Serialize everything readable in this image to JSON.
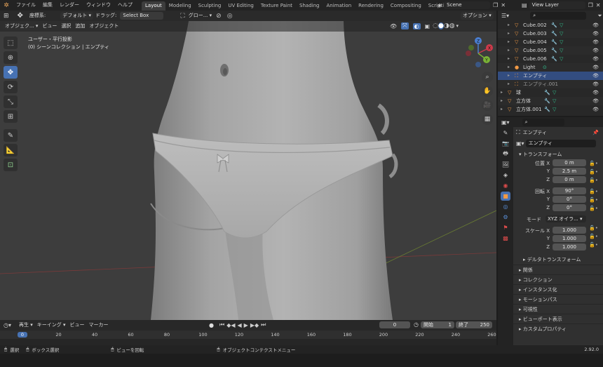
{
  "menu": {
    "items": [
      "ファイル",
      "編集",
      "レンダー",
      "ウィンドウ",
      "ヘルプ"
    ],
    "workspaces": [
      "Layout",
      "Modeling",
      "Sculpting",
      "UV Editing",
      "Texture Paint",
      "Shading",
      "Animation",
      "Rendering",
      "Compositing",
      "Scripting"
    ],
    "active_workspace": "Layout",
    "scene": "Scene",
    "view_layer": "View Layer"
  },
  "tool_header": {
    "coord_label": "座標系:",
    "coord_value": "デフォルト",
    "drag_label": "ドラッグ:",
    "drag_value": "Select Box",
    "pivot_value": "グロー...",
    "options": "オプション"
  },
  "viewport": {
    "mode": "オブジェク...",
    "menus": [
      "ビュー",
      "選択",
      "追加",
      "オブジェクト"
    ],
    "view_name": "ユーザー・平行投影",
    "collection_info": "(0) シーンコレクション | エンプティ",
    "gizmo": {
      "x": "X",
      "y": "Y",
      "z": "Z"
    },
    "colors": {
      "bg": "#3d3d3d",
      "x_axis": "#a33b3b",
      "y_axis": "#7a9a2e",
      "accent": "#4772b3"
    }
  },
  "outliner": {
    "rows": [
      {
        "name": "Cube.002",
        "type": "mesh",
        "selected": false
      },
      {
        "name": "Cube.003",
        "type": "mesh",
        "selected": false
      },
      {
        "name": "Cube.004",
        "type": "mesh",
        "selected": false
      },
      {
        "name": "Cube.005",
        "type": "mesh",
        "selected": false
      },
      {
        "name": "Cube.006",
        "type": "mesh",
        "selected": false
      },
      {
        "name": "Light",
        "type": "light",
        "selected": false
      },
      {
        "name": "エンプティ",
        "type": "empty",
        "selected": true
      },
      {
        "name": "エンプティ.001",
        "type": "empty",
        "selected": false
      },
      {
        "name": "球",
        "type": "mesh",
        "selected": false
      },
      {
        "name": "立方体",
        "type": "mesh",
        "selected": false
      },
      {
        "name": "立方体.001",
        "type": "mesh",
        "selected": false
      }
    ]
  },
  "properties": {
    "object_name": "エンプティ",
    "data_name": "エンプティ",
    "transform_title": "トランスフォーム",
    "location": {
      "label": "位置 X",
      "x": "0 m",
      "y": "2.5 m",
      "z": "0 m"
    },
    "rotation": {
      "label": "回転 X",
      "x": "90°",
      "y": "0°",
      "z": "0°"
    },
    "mode_label": "モード",
    "mode_value": "XYZ オイラ...",
    "scale": {
      "label": "スケール X",
      "x": "1.000",
      "y": "1.000",
      "z": "1.000"
    },
    "axis_y": "Y",
    "axis_z": "Z",
    "delta": "デルタトランスフォーム",
    "sections": [
      "関係",
      "コレクション",
      "インスタンス化",
      "モーションパス",
      "可視性",
      "ビューポート表示",
      "カスタムプロパティ"
    ]
  },
  "timeline": {
    "menus": [
      "再生",
      "キーイング",
      "ビュー",
      "マーカー"
    ],
    "current_frame": "0",
    "start_label": "開始",
    "start_value": "1",
    "end_label": "終了",
    "end_value": "250",
    "ruler": [
      "0",
      "20",
      "40",
      "60",
      "80",
      "100",
      "120",
      "140",
      "160",
      "180",
      "200",
      "220",
      "240",
      "260"
    ]
  },
  "status": {
    "select": "選択",
    "box_select": "ボックス選択",
    "rotate_view": "ビューを回転",
    "context_menu": "オブジェクトコンテクストメニュー",
    "version": "2.92.0"
  }
}
